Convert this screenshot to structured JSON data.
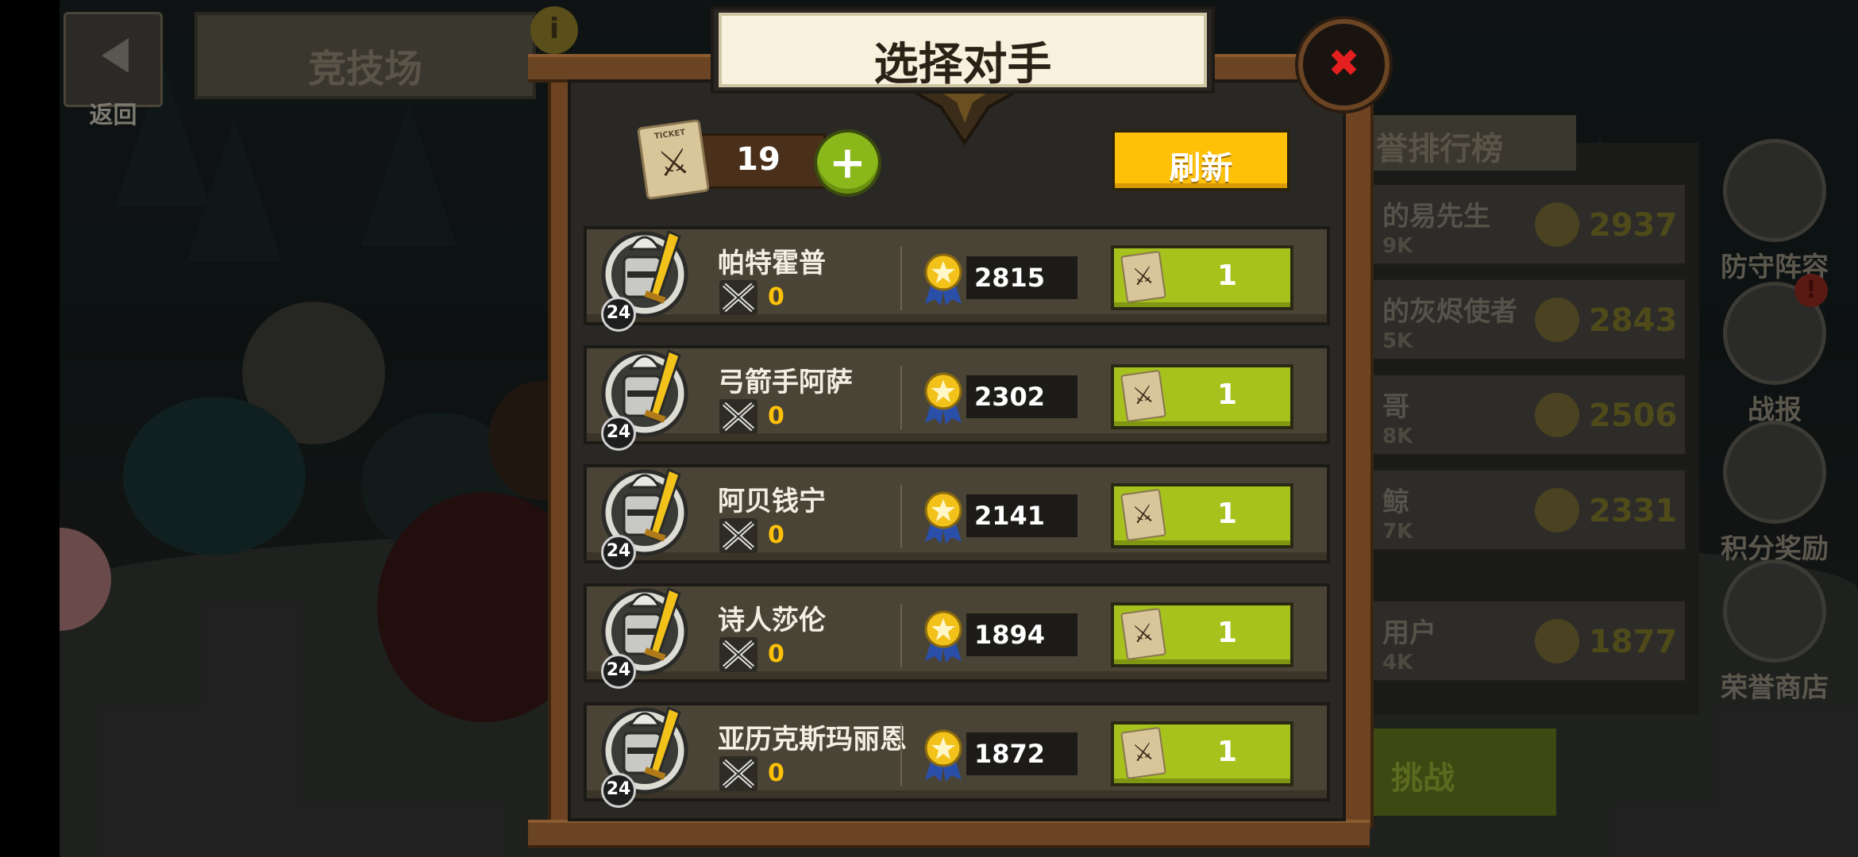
{
  "background": {
    "back_label": "返回",
    "arena_title": "竞技场",
    "info_glyph": "i",
    "leaderboard_title": "誉排行榜",
    "leaderboard_rows": [
      {
        "name": "的易先生",
        "sub": "9K",
        "score": "2937"
      },
      {
        "name": "的灰烬使者",
        "sub": "5K",
        "score": "2843"
      },
      {
        "name": "哥",
        "sub": "8K",
        "score": "2506"
      },
      {
        "name": "鲸",
        "sub": "7K",
        "score": "2331"
      },
      {
        "name": "用户",
        "sub": "4K",
        "score": "1877"
      }
    ],
    "challenge_label": "挑战",
    "side_buttons": [
      {
        "label": "防守阵容",
        "icon": "shield-icon"
      },
      {
        "label": "战报",
        "icon": "scroll-icon"
      },
      {
        "label": "积分奖励",
        "icon": "star-medal-icon"
      },
      {
        "label": "荣誉商店",
        "icon": "gem-icon"
      }
    ],
    "alert_glyph": "!"
  },
  "modal": {
    "title": "选择对手",
    "close_glyph": "✖",
    "ticket_label": "TICKET",
    "ticket_count": "19",
    "add_glyph": "+",
    "refresh_label": "刷新"
  },
  "opponents": [
    {
      "name": "帕特霍普",
      "level": "24",
      "wins": "0",
      "score": "2815",
      "cost": "1"
    },
    {
      "name": "弓箭手阿萨",
      "level": "24",
      "wins": "0",
      "score": "2302",
      "cost": "1"
    },
    {
      "name": "阿贝钱宁",
      "level": "24",
      "wins": "0",
      "score": "2141",
      "cost": "1"
    },
    {
      "name": "诗人莎伦",
      "level": "24",
      "wins": "0",
      "score": "1894",
      "cost": "1"
    },
    {
      "name": "亚历克斯玛丽恩",
      "level": "24",
      "wins": "0",
      "score": "1872",
      "cost": "1"
    }
  ],
  "colors": {
    "refresh": "#ffc108",
    "fight": "#a7c21c",
    "add": "#8ab81a",
    "close_x": "#e51f1f",
    "wins": "#ffc108"
  }
}
